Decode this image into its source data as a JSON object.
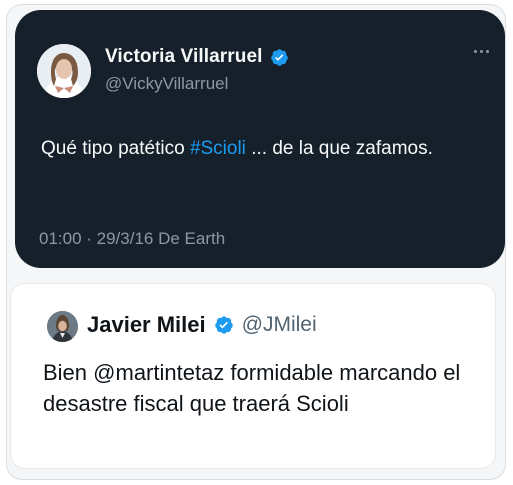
{
  "colors": {
    "tweet_bg": "#15202b",
    "accent_blue": "#1d9bf0",
    "muted_text": "#8b98a5",
    "quote_bg": "#ffffff"
  },
  "main_tweet": {
    "author_name": "Victoria Villarruel",
    "author_handle": "@VickyVillarruel",
    "verified_icon": "verified-badge-icon",
    "more_icon": "more-dots-icon",
    "text_before": "Qué tipo patético ",
    "hashtag": "#Scioli",
    "text_after": " ... de la que zafamos.",
    "meta": "01:00 · 29/3/16 De Earth"
  },
  "quoted_tweet": {
    "author_name": "Javier Milei",
    "author_handle": "@JMilei",
    "verified_icon": "verified-badge-icon",
    "text_prefix": "Bien ",
    "mention": "@martintetaz",
    "text_suffix": " formidable marcando el desastre fiscal que traerá Scioli"
  }
}
